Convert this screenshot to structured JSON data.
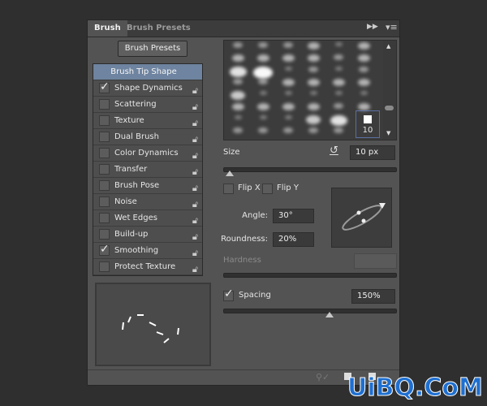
{
  "tabs": [
    {
      "label": "Brush",
      "active": true
    },
    {
      "label": "Brush Presets",
      "active": false
    }
  ],
  "presets_button": "Brush Presets",
  "options": [
    {
      "label": "Brush Tip Shape",
      "selected": true
    },
    {
      "label": "Shape Dynamics",
      "checked": true,
      "lock": true
    },
    {
      "label": "Scattering",
      "checked": false,
      "lock": true
    },
    {
      "label": "Texture",
      "checked": false,
      "lock": true
    },
    {
      "label": "Dual Brush",
      "checked": false,
      "lock": true
    },
    {
      "label": "Color Dynamics",
      "checked": false,
      "lock": true
    },
    {
      "label": "Transfer",
      "checked": false,
      "lock": true
    },
    {
      "label": "Brush Pose",
      "checked": false,
      "lock": true
    },
    {
      "label": "Noise",
      "checked": false,
      "lock": true
    },
    {
      "label": "Wet Edges",
      "checked": false,
      "lock": true
    },
    {
      "label": "Build-up",
      "checked": false,
      "lock": true
    },
    {
      "label": "Smoothing",
      "checked": true,
      "lock": true
    },
    {
      "label": "Protect Texture",
      "checked": false,
      "lock": true
    }
  ],
  "selected_tip": {
    "size": "10"
  },
  "size": {
    "label": "Size",
    "value": "10 px",
    "slider_fraction": 0.04
  },
  "flip_x": {
    "label": "Flip X",
    "checked": false
  },
  "flip_y": {
    "label": "Flip Y",
    "checked": false
  },
  "angle": {
    "label": "Angle:",
    "value": "30°"
  },
  "roundness": {
    "label": "Roundness:",
    "value": "20%"
  },
  "hardness": {
    "label": "Hardness",
    "value": ""
  },
  "spacing": {
    "label": "Spacing",
    "checked": true,
    "value": "150%",
    "slider_fraction": 0.62
  },
  "watermark": "UiBQ.CoM",
  "colors": {
    "selection": "#6e84a0",
    "panel": "#535353",
    "background": "#2f2f2f",
    "watermark": "#1e6fd0"
  }
}
